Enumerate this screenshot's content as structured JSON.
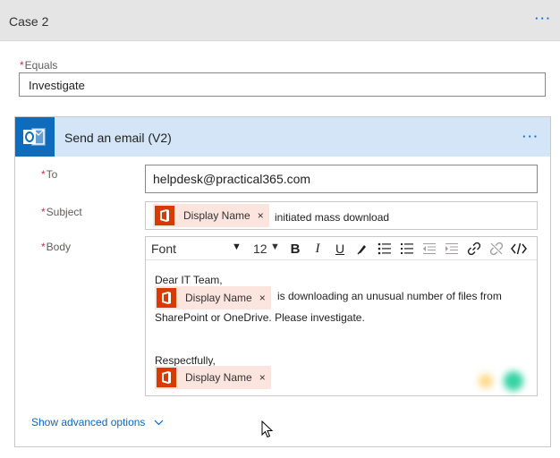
{
  "case": {
    "title": "Case 2",
    "more_label": "···"
  },
  "equals": {
    "label": "Equals",
    "value": "Investigate"
  },
  "action": {
    "title": "Send an email (V2)",
    "more_label": "···",
    "icon": "outlook-icon",
    "to": {
      "label": "To",
      "value": "helpdesk@practical365.com"
    },
    "subject": {
      "label": "Subject",
      "token_label": "Display Name",
      "token_remove": "×",
      "text": "initiated mass download"
    },
    "body": {
      "label": "Body",
      "toolbar": {
        "font": "Font",
        "font_caret": "▼",
        "size": "12",
        "size_caret": "▼",
        "bold": "B",
        "italic": "I",
        "underline": "U"
      },
      "greeting": "Dear IT Team,",
      "token1_label": "Display Name",
      "token1_remove": "×",
      "line1": "is downloading an unusual number of files from",
      "line2": "SharePoint or OneDrive. Please investigate.",
      "closing": "Respectfully,",
      "token2_label": "Display Name",
      "token2_remove": "×"
    },
    "advanced_options": "Show advanced options"
  },
  "colors": {
    "accent": "#0a66c2",
    "token_bg": "#fce4df",
    "office_orange": "#d83b01",
    "header_bg": "#d3e5f6",
    "required": "#c4314b"
  }
}
